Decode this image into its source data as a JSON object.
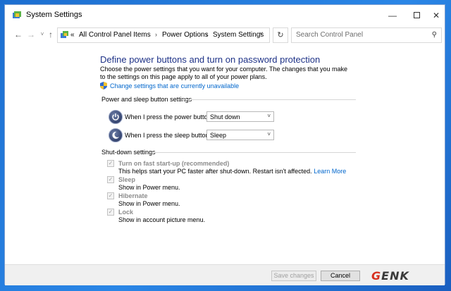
{
  "window": {
    "title": "System Settings",
    "controls": {
      "minimize": "—",
      "close": "✕"
    }
  },
  "nav": {
    "back": "←",
    "forward": "→",
    "recent": "˅",
    "up": "↑",
    "breadcrumbs": [
      "«",
      "All Control Panel Items",
      "Power Options",
      "System Settings"
    ],
    "separator": "›",
    "dropdown": "˅",
    "refresh": "↻",
    "search_placeholder": "Search Control Panel",
    "search_icon": "⚲"
  },
  "content": {
    "heading": "Define power buttons and turn on password protection",
    "description": "Choose the power settings that you want for your computer. The changes that you make to the settings on this page apply to all of your power plans.",
    "change_link": "Change settings that are currently unavailable",
    "power_section_title": "Power and sleep button settings",
    "power_button_label": "When I press the power button:",
    "power_button_value": "Shut down",
    "sleep_button_label": "When I press the sleep button:",
    "sleep_button_value": "Sleep",
    "shutdown_section_title": "Shut-down settings",
    "options": [
      {
        "label": "Turn on fast start-up (recommended)",
        "desc": "This helps start your PC faster after shut-down. Restart isn't affected.",
        "link": "Learn More",
        "checked": true
      },
      {
        "label": "Sleep",
        "desc": "Show in Power menu.",
        "checked": true
      },
      {
        "label": "Hibernate",
        "desc": "Show in Power menu.",
        "checked": true
      },
      {
        "label": "Lock",
        "desc": "Show in account picture menu.",
        "checked": true
      }
    ],
    "check_mark": "✓",
    "select_arrow": "˅"
  },
  "footer": {
    "save_label": "Save changes",
    "cancel_label": "Cancel"
  },
  "watermark": {
    "first": "G",
    "rest": "ENK"
  },
  "colors": {
    "heading": "#1e3287",
    "link": "#0066cc",
    "desktop": "#2a86e6"
  }
}
